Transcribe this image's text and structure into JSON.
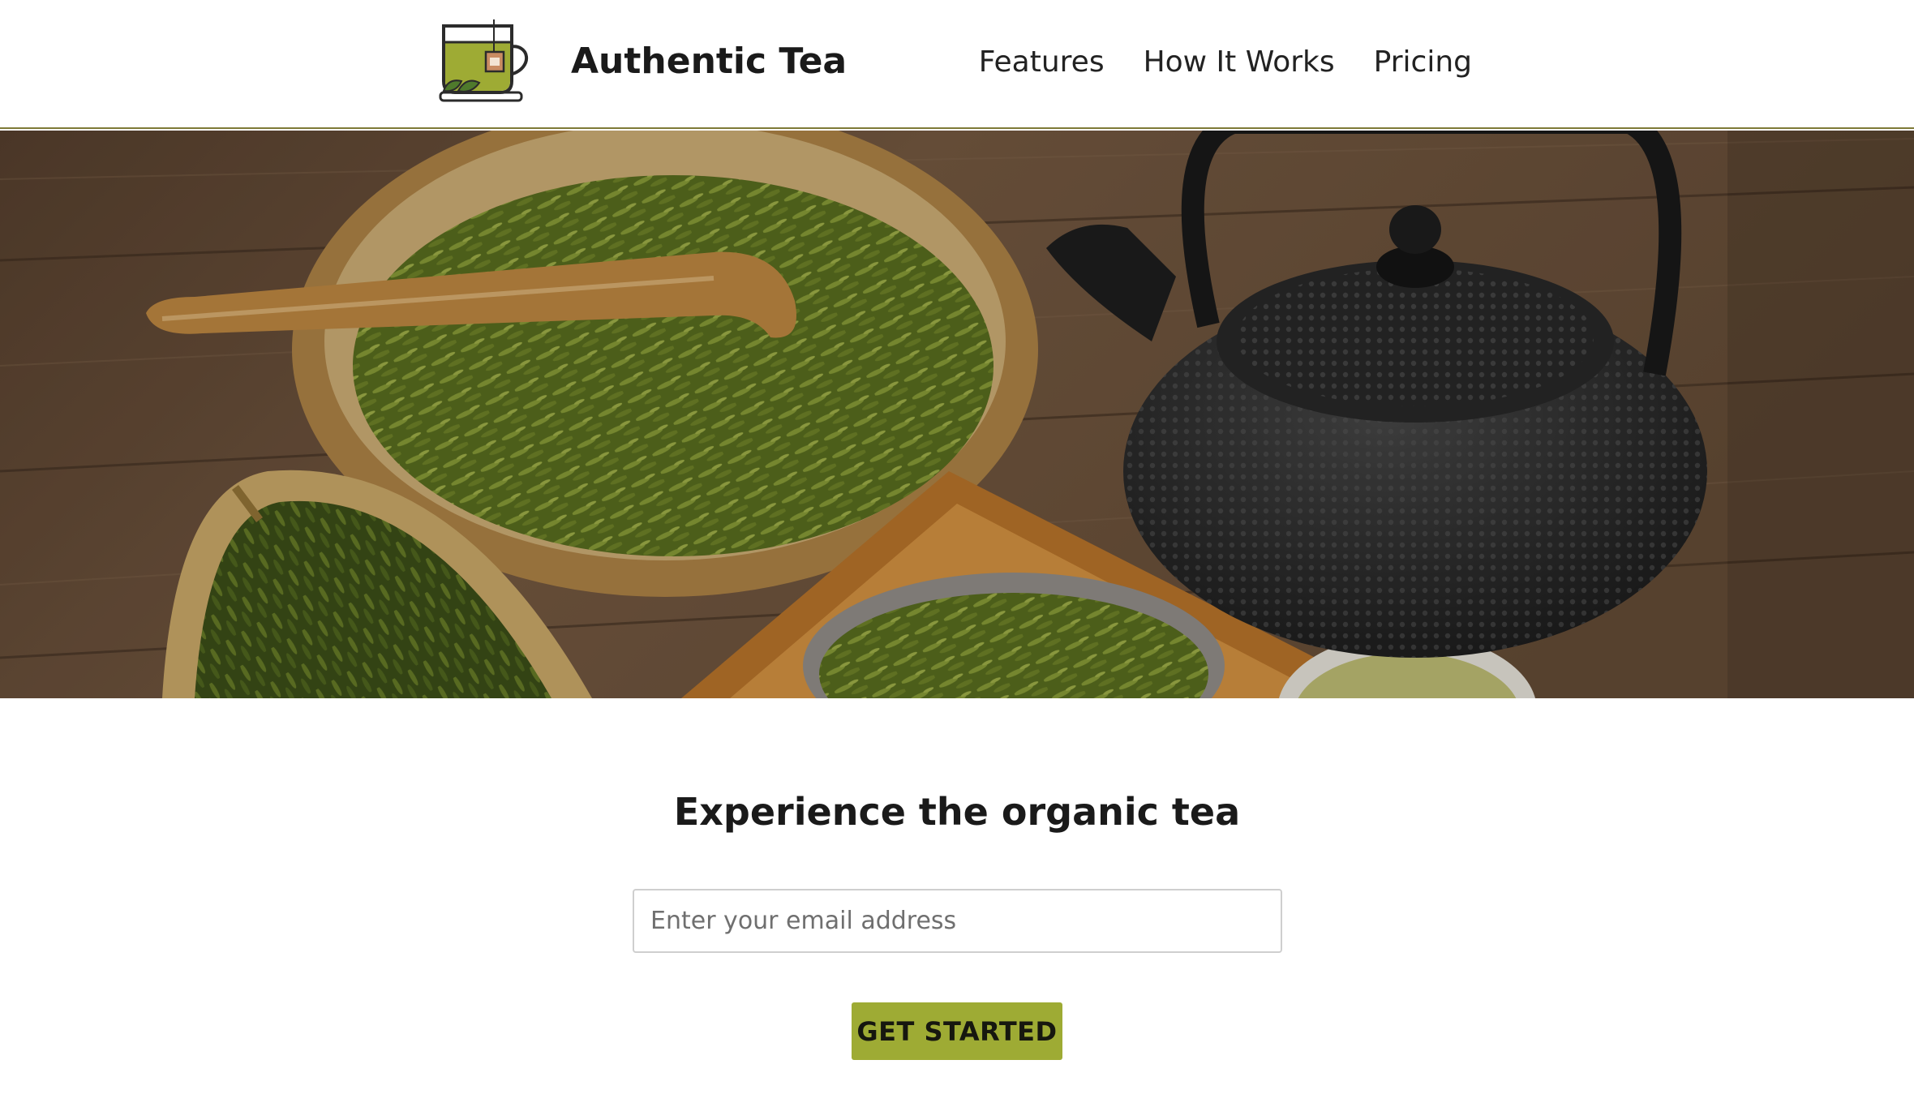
{
  "brand": {
    "name": "Authentic Tea",
    "logo_icon": "tea-cup-with-leaf-icon"
  },
  "nav": {
    "items": [
      {
        "label": "Features"
      },
      {
        "label": "How It Works"
      },
      {
        "label": "Pricing"
      }
    ]
  },
  "hero": {
    "image": "green-tea-leaves-and-cast-iron-teapot-photo"
  },
  "signup": {
    "headline": "Experience the organic tea",
    "email_placeholder": "Enter your email address",
    "email_value": "",
    "button_label": "GET STARTED"
  },
  "colors": {
    "accent": "#9eab34",
    "header_border": "#7e7a37",
    "text": "#1a1a1a"
  }
}
